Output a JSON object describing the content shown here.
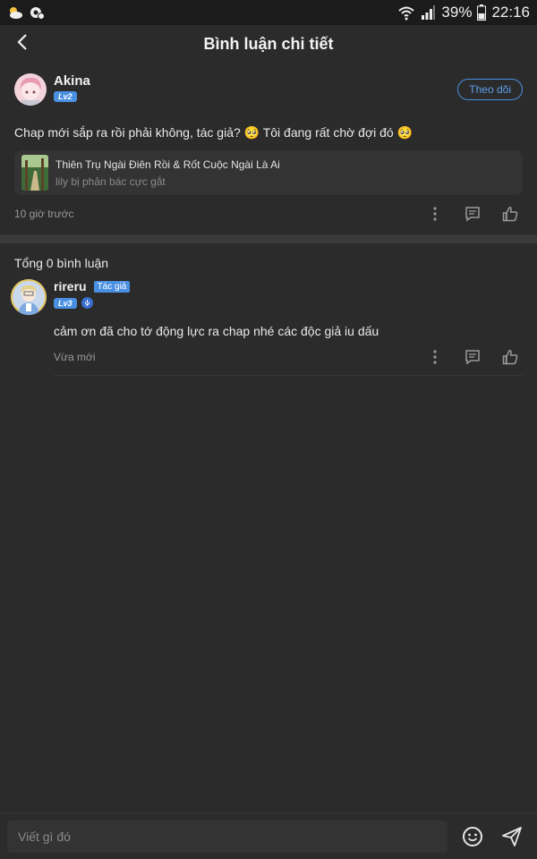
{
  "status_bar": {
    "battery": "39%",
    "time": "22:16",
    "left_icons": [
      "weather-icon",
      "settings-icon"
    ],
    "right_icons": [
      "wifi-icon",
      "signal-icon",
      "battery-icon"
    ]
  },
  "header": {
    "title": "Bình luận chi tiết",
    "back_icon": "back-arrow-icon"
  },
  "post": {
    "author": "Akina",
    "level": "Lv2",
    "follow_label": "Theo dõi",
    "text": "Chap mới sắp ra rồi phải không, tác giả? 🥺 Tôi đang rất chờ đợi đó 🥺",
    "book": {
      "title": "Thiên Trụ Ngài Điên Rồi & Rốt Cuộc Ngài Là Ai",
      "subtitle": "lily bị phản bác cực gắt"
    },
    "time": "10 giờ trước"
  },
  "comments_total": "Tổng 0 bình luận",
  "comments": [
    {
      "author": "rireru",
      "tag": "Tác giả",
      "level": "Lv3",
      "text": "cảm ơn đã cho tớ động lực ra chap nhé các độc giả iu dấu",
      "time": "Vừa mới"
    }
  ],
  "input": {
    "placeholder": "Viết gì đó",
    "emoji_icon": "emoji-icon",
    "send_icon": "send-icon"
  },
  "colors": {
    "background": "#2b2b2b",
    "accent": "#4a90e2",
    "text": "#e8e8e8",
    "muted": "#9a9a9a"
  }
}
